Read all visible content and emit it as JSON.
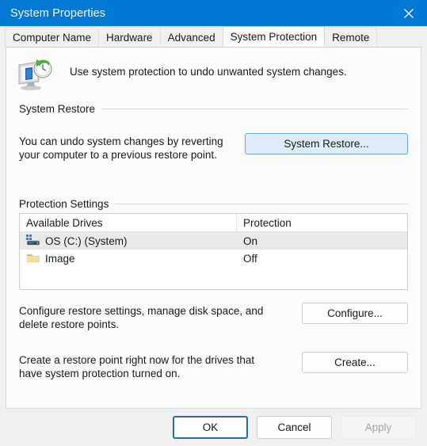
{
  "window": {
    "title": "System Properties",
    "close_icon": "close-icon",
    "titlebar_color": "#0078d4"
  },
  "tabs": [
    {
      "label": "Computer Name",
      "active": false
    },
    {
      "label": "Hardware",
      "active": false
    },
    {
      "label": "Advanced",
      "active": false
    },
    {
      "label": "System Protection",
      "active": true
    },
    {
      "label": "Remote",
      "active": false
    }
  ],
  "intro": {
    "icon": "system-restore-icon",
    "text": "Use system protection to undo unwanted system changes."
  },
  "system_restore": {
    "group_title": "System Restore",
    "description": "You can undo system changes by reverting\nyour computer to a previous restore point.",
    "button_label": "System Restore...",
    "button_state": "hovered",
    "button_hover_bg": "#dcedf7",
    "button_hover_border": "#6ca8d4"
  },
  "protection_settings": {
    "group_title": "Protection Settings",
    "columns": [
      "Available Drives",
      "Protection"
    ],
    "rows": [
      {
        "icon": "hard-drive-icon",
        "drive": "OS (C:) (System)",
        "protection": "On",
        "selected": true
      },
      {
        "icon": "folder-icon",
        "drive": "Image",
        "protection": "Off",
        "selected": false
      }
    ],
    "configure": {
      "description": "Configure restore settings, manage disk space, and\ndelete restore points.",
      "button_label": "Configure..."
    },
    "create": {
      "description": "Create a restore point right now for the drives that\nhave system protection turned on.",
      "button_label": "Create..."
    }
  },
  "footer": {
    "ok_label": "OK",
    "cancel_label": "Cancel",
    "apply_label": "Apply",
    "apply_enabled": false,
    "focus_ring_color": "#2b6ca3"
  }
}
